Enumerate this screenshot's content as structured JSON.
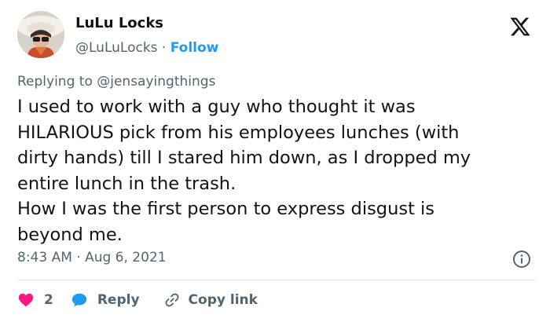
{
  "author": {
    "display_name": "LuLu Locks",
    "handle": "@LuLuLocks",
    "separator": " · ",
    "follow_label": "Follow"
  },
  "replying_to": "Replying to @jensayingthings",
  "tweet": {
    "text": "I used to work with a guy who thought it was\nHILARIOUS pick from his employees lunches (with\ndirty hands) till I stared him down, as I dropped my\nentire lunch in the trash.\nHow I was the first person to express disgust is\nbeyond me."
  },
  "timestamp": "8:43 AM · Aug 6, 2021",
  "actions": {
    "like_count": "2",
    "reply_label": "Reply",
    "copy_label": "Copy link"
  },
  "icons": {
    "brand": "x-logo-icon",
    "info": "info-icon",
    "like": "heart-icon",
    "reply": "speech-bubble-icon",
    "copy": "link-icon"
  },
  "colors": {
    "accent": "#1d9bf0",
    "like": "#f91880",
    "secondary_text": "#536471",
    "primary_text": "#0f1419"
  }
}
